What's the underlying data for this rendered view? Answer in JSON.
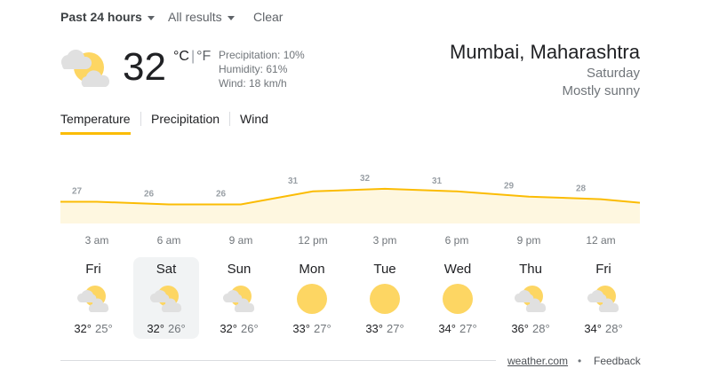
{
  "filters": {
    "time": "Past 24 hours",
    "results": "All results",
    "clear": "Clear"
  },
  "current": {
    "temperature": "32",
    "unit_c": "°C",
    "unit_sep": "|",
    "unit_f": "°F",
    "precipitation": "Precipitation: 10%",
    "humidity": "Humidity: 61%",
    "wind": "Wind: 18 km/h",
    "icon": "partly-cloudy-icon"
  },
  "location": {
    "name": "Mumbai, Maharashtra",
    "day": "Saturday",
    "condition": "Mostly sunny"
  },
  "tabs": [
    {
      "label": "Temperature",
      "active": true
    },
    {
      "label": "Precipitation",
      "active": false
    },
    {
      "label": "Wind",
      "active": false
    }
  ],
  "chart_data": {
    "type": "area",
    "x": [
      "3 am",
      "6 am",
      "9 am",
      "12 pm",
      "3 pm",
      "6 pm",
      "9 pm",
      "12 am"
    ],
    "values": [
      27,
      26,
      26,
      31,
      32,
      31,
      29,
      28
    ],
    "color": "#fbbc04",
    "fill": "#fef7e0"
  },
  "forecast": [
    {
      "day": "Fri",
      "high": "32°",
      "low": "25°",
      "icon": "partly-cloudy-icon",
      "selected": false
    },
    {
      "day": "Sat",
      "high": "32°",
      "low": "26°",
      "icon": "partly-cloudy-icon",
      "selected": true
    },
    {
      "day": "Sun",
      "high": "32°",
      "low": "26°",
      "icon": "partly-cloudy-icon",
      "selected": false
    },
    {
      "day": "Mon",
      "high": "33°",
      "low": "27°",
      "icon": "sunny-icon",
      "selected": false
    },
    {
      "day": "Tue",
      "high": "33°",
      "low": "27°",
      "icon": "sunny-icon",
      "selected": false
    },
    {
      "day": "Wed",
      "high": "34°",
      "low": "27°",
      "icon": "sunny-icon",
      "selected": false
    },
    {
      "day": "Thu",
      "high": "36°",
      "low": "28°",
      "icon": "partly-cloudy-icon",
      "selected": false
    },
    {
      "day": "Fri",
      "high": "34°",
      "low": "28°",
      "icon": "partly-cloudy-icon",
      "selected": false
    }
  ],
  "footer": {
    "source": "weather.com",
    "separator": "•",
    "feedback": "Feedback"
  }
}
